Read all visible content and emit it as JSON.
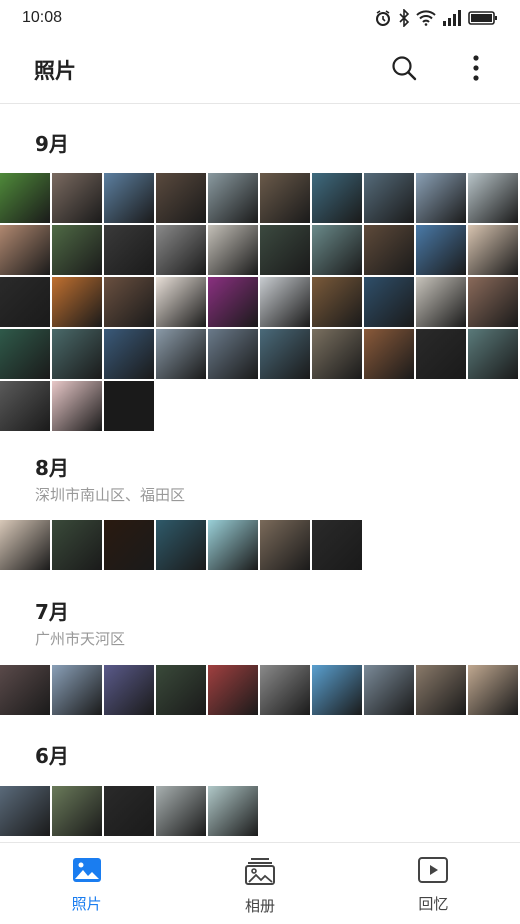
{
  "status_bar": {
    "time": "10:08"
  },
  "app_bar": {
    "title": "照片",
    "search_icon": "search-icon",
    "more_icon": "more-vertical-icon"
  },
  "sections": [
    {
      "title": "9月",
      "subtitle": "",
      "photos": [
        "#4f8a3a",
        "#7a6a60",
        "#5c7fa0",
        "#5a4a3e",
        "#8a9aa0",
        "#6a5a4a",
        "#3f6b7f",
        "#556b7a",
        "#8aa0b5",
        "#b8c4c8",
        "#b08870",
        "#4f6a45",
        "#3a3a3a",
        "#8a8a8a",
        "#c4c0b8",
        "#3c4a40",
        "#6a8a8a",
        "#5e4a3a",
        "#4a7aa8",
        "#d8c4b0",
        "#2a2a2a",
        "#c07030",
        "#6a5040",
        "#e8e0d8",
        "#8a3080",
        "#c8ccd0",
        "#7a5a3a",
        "#2f4f6a",
        "#c8c4bc",
        "#8a6a5a",
        "#2f5a4a",
        "#4a6a6a",
        "#3a5a7a",
        "#8a9aa8",
        "#6a7a8a",
        "#4a6a7a",
        "#7a7060",
        "#8a5a3a",
        "#2a2a2a",
        "#5a7a7a",
        "#5a5a5a",
        "#e8c8c8",
        "#1a1a1a"
      ]
    },
    {
      "title": "8月",
      "subtitle": "深圳市南山区、福田区",
      "photos": [
        "#d8c8b8",
        "#3a4a3a",
        "#2a1a10",
        "#2f5a6a",
        "#9ad0d8",
        "#7a6a5a",
        "#2a2a2a"
      ]
    },
    {
      "title": "7月",
      "subtitle": "广州市天河区",
      "photos": [
        "#5a4a4a",
        "#8aa0b8",
        "#5a5a8a",
        "#3a4a3a",
        "#a04040",
        "#8a8a8a",
        "#5aa0d0",
        "#7a8a98",
        "#8a7a6a",
        "#c0a890"
      ]
    },
    {
      "title": "6月",
      "subtitle": "",
      "photos": [
        "#5a6a7a",
        "#6a7a5a",
        "#2a2a2a",
        "#a8b0b0",
        "#b0c8c8"
      ]
    }
  ],
  "bottom_nav": [
    {
      "label": "照片",
      "icon": "image-icon",
      "active": true
    },
    {
      "label": "相册",
      "icon": "album-icon",
      "active": false
    },
    {
      "label": "回忆",
      "icon": "play-icon",
      "active": false
    }
  ],
  "colors": {
    "accent": "#1a7df0",
    "inactive": "#444444",
    "divider": "#e6e6e6"
  }
}
